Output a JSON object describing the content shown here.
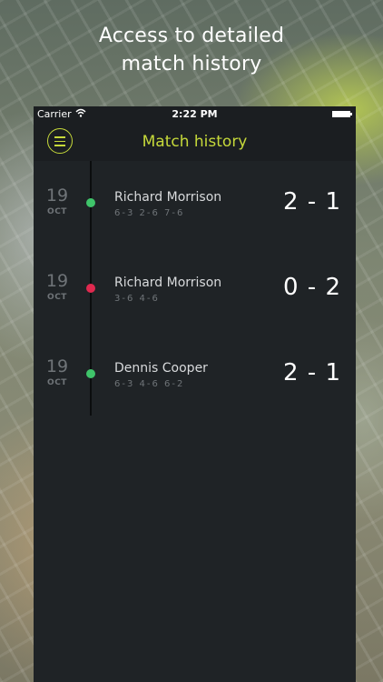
{
  "headline": {
    "line1": "Access to detailed",
    "line2": "match history"
  },
  "status_bar": {
    "carrier": "Carrier",
    "time": "2:22 PM"
  },
  "nav": {
    "title": "Match history",
    "menu_icon": "hamburger-icon"
  },
  "colors": {
    "accent": "#c6d93a",
    "win": "#3fc46a",
    "loss": "#e0294f",
    "panel": "#1f2326"
  },
  "matches": [
    {
      "day": "19",
      "month": "OCT",
      "opponent": "Richard Morrison",
      "sets": "6-3 2-6 7-6",
      "score": "2 - 1",
      "result": "win"
    },
    {
      "day": "19",
      "month": "OCT",
      "opponent": "Richard Morrison",
      "sets": "3-6 4-6",
      "score": "0 - 2",
      "result": "loss"
    },
    {
      "day": "19",
      "month": "OCT",
      "opponent": "Dennis Cooper",
      "sets": "6-3 4-6 6-2",
      "score": "2 - 1",
      "result": "win"
    }
  ]
}
